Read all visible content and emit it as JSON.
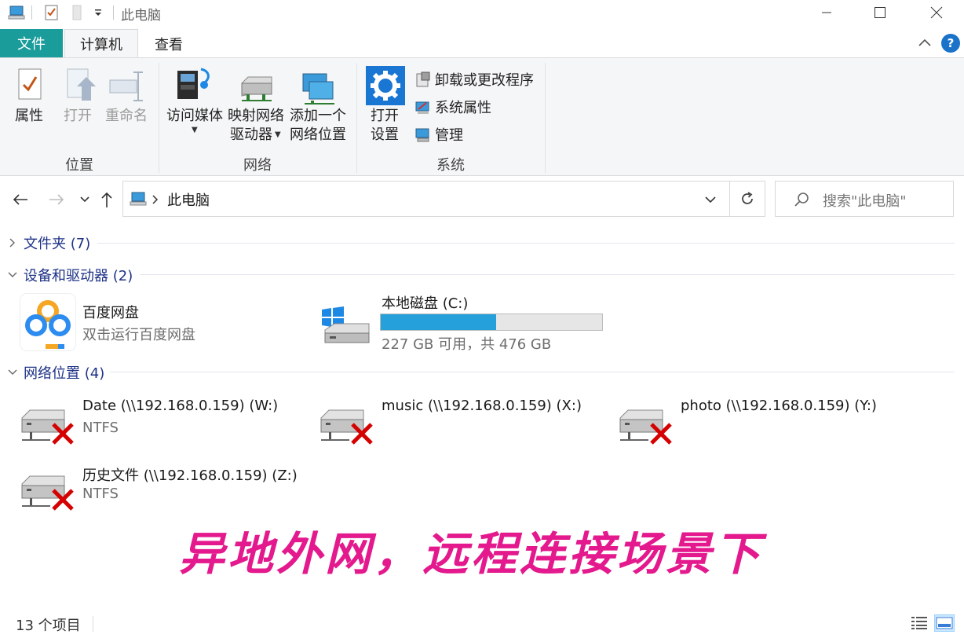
{
  "window": {
    "title": "此电脑",
    "minimize_icon": "minimize-icon",
    "maximize_icon": "maximize-icon",
    "close_icon": "close-icon"
  },
  "ribbon": {
    "tabs": [
      {
        "label": "文件"
      },
      {
        "label": "计算机"
      },
      {
        "label": "查看"
      }
    ],
    "groups": [
      {
        "label": "位置"
      },
      {
        "label": "网络"
      },
      {
        "label": "系统"
      }
    ],
    "location": {
      "properties": "属性",
      "open": "打开",
      "rename": "重命名"
    },
    "network": {
      "access_media": "访问媒体",
      "map_drive_line1": "映射网络",
      "map_drive_line2": "驱动器",
      "add_location_line1": "添加一个",
      "add_location_line2": "网络位置"
    },
    "system": {
      "open_settings_line1": "打开",
      "open_settings_line2": "设置",
      "uninstall": "卸载或更改程序",
      "system_properties": "系统属性",
      "manage": "管理"
    }
  },
  "address": {
    "path": "此电脑",
    "search_placeholder": "搜索\"此电脑\""
  },
  "content": {
    "folders_group": "文件夹 (7)",
    "devices_group": "设备和驱动器 (2)",
    "network_group": "网络位置 (4)",
    "devices": [
      {
        "title": "百度网盘",
        "subtitle": "双击运行百度网盘"
      },
      {
        "title": "本地磁盘 (C:)",
        "subtitle": "227 GB 可用，共 476 GB",
        "used_fraction": 0.523
      }
    ],
    "network_locations": [
      {
        "title": "Date (\\\\192.168.0.159) (W:)",
        "subtitle": "NTFS"
      },
      {
        "title": "music (\\\\192.168.0.159) (X:)",
        "subtitle": ""
      },
      {
        "title": "photo (\\\\192.168.0.159) (Y:)",
        "subtitle": ""
      },
      {
        "title": "历史文件 (\\\\192.168.0.159) (Z:)",
        "subtitle": "NTFS"
      }
    ]
  },
  "overlay_caption": "异地外网，远程连接场景下",
  "status": {
    "item_count": "13 个项目"
  },
  "colors": {
    "file_tab": "#1a9c9a",
    "accent_blue": "#26a0da",
    "overlay": "#e3198d",
    "group_header": "#1e3287"
  }
}
